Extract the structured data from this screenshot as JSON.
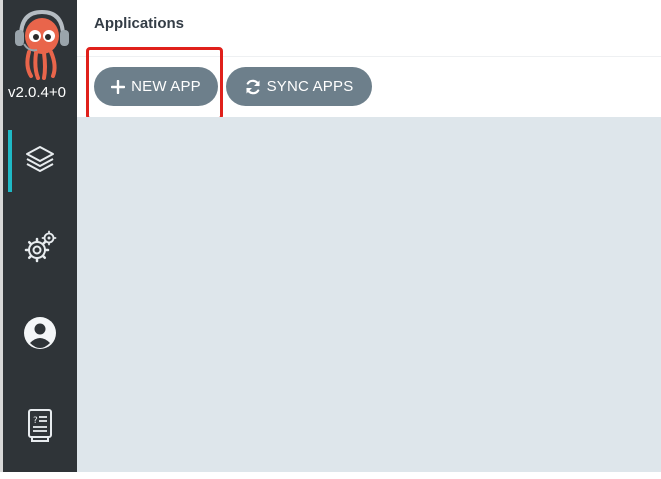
{
  "sidebar": {
    "version": "v2.0.4+0",
    "items": [
      {
        "name": "applications",
        "icon": "layers-icon"
      },
      {
        "name": "settings",
        "icon": "settings-gears-icon"
      },
      {
        "name": "user-info",
        "icon": "user-avatar-icon"
      },
      {
        "name": "documentation",
        "icon": "docs-book-icon"
      }
    ],
    "logo": "argo-octopus-logo"
  },
  "header": {
    "title": "Applications"
  },
  "toolbar": {
    "new_app_label": "NEW APP",
    "sync_apps_label": "SYNC APPS"
  },
  "colors": {
    "sidebar_bg": "#2f3438",
    "button_bg": "#6d7f8b",
    "content_bg": "#dee6eb",
    "active_indicator": "#1fb9c6",
    "highlight": "#e0201b"
  }
}
